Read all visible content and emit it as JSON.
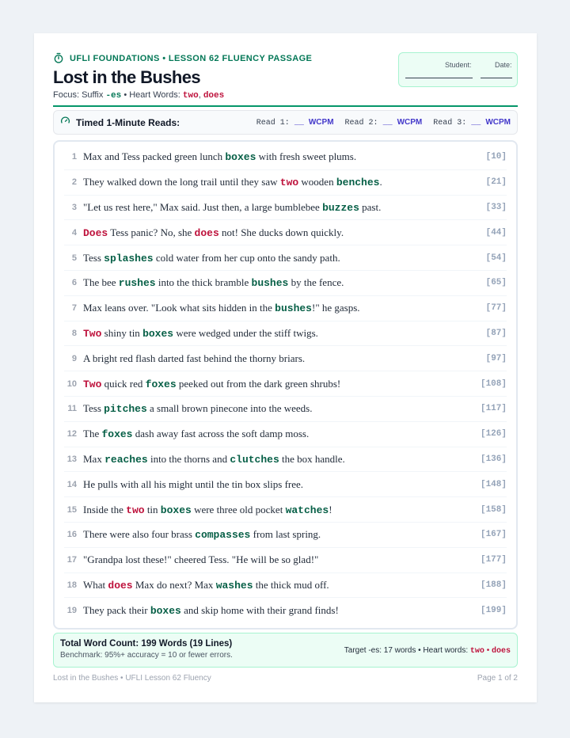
{
  "header": {
    "kicker": "UFLI FOUNDATIONS • LESSON 62 FLUENCY PASSAGE",
    "title": "Lost in the Bushes",
    "focus_prefix": "Focus: Suffix",
    "focus_suffix": "-es",
    "focus_heart_label": "• Heart Words:",
    "heart_word_1": "two",
    "heart_sep": ",",
    "heart_word_2": "does",
    "student_label": "Student:",
    "date_label": "Date:"
  },
  "timed": {
    "label": "Timed 1-Minute Reads:",
    "reads": [
      {
        "label": "Read 1:",
        "blank": "__",
        "unit": "WCPM"
      },
      {
        "label": "Read 2:",
        "blank": "__",
        "unit": "WCPM"
      },
      {
        "label": "Read 3:",
        "blank": "__",
        "unit": "WCPM"
      }
    ]
  },
  "passage": [
    {
      "num": "1",
      "count": "[10]",
      "parts": [
        [
          "t",
          "Max and Tess packed green lunch "
        ],
        [
          "g",
          "boxes"
        ],
        [
          "t",
          " with fresh sweet plums."
        ]
      ]
    },
    {
      "num": "2",
      "count": "[21]",
      "parts": [
        [
          "t",
          "They walked down the long trail until they saw "
        ],
        [
          "r",
          "two"
        ],
        [
          "t",
          " wooden "
        ],
        [
          "g",
          "benches"
        ],
        [
          "t",
          "."
        ]
      ]
    },
    {
      "num": "3",
      "count": "[33]",
      "parts": [
        [
          "t",
          "\"Let us rest here,\" Max said. Just then, a large bumblebee "
        ],
        [
          "g",
          "buzzes"
        ],
        [
          "t",
          " past."
        ]
      ]
    },
    {
      "num": "4",
      "count": "[44]",
      "parts": [
        [
          "r",
          "Does"
        ],
        [
          "t",
          " Tess panic? No, she "
        ],
        [
          "r",
          "does"
        ],
        [
          "t",
          " not! She ducks down quickly."
        ]
      ]
    },
    {
      "num": "5",
      "count": "[54]",
      "parts": [
        [
          "t",
          "Tess "
        ],
        [
          "g",
          "splashes"
        ],
        [
          "t",
          " cold water from her cup onto the sandy path."
        ]
      ]
    },
    {
      "num": "6",
      "count": "[65]",
      "parts": [
        [
          "t",
          "The bee "
        ],
        [
          "g",
          "rushes"
        ],
        [
          "t",
          " into the thick bramble "
        ],
        [
          "g",
          "bushes"
        ],
        [
          "t",
          " by the fence."
        ]
      ]
    },
    {
      "num": "7",
      "count": "[77]",
      "parts": [
        [
          "t",
          "Max leans over. \"Look what sits hidden in the "
        ],
        [
          "g",
          "bushes"
        ],
        [
          "t",
          "!\" he gasps."
        ]
      ]
    },
    {
      "num": "8",
      "count": "[87]",
      "parts": [
        [
          "r",
          "Two"
        ],
        [
          "t",
          " shiny tin "
        ],
        [
          "g",
          "boxes"
        ],
        [
          "t",
          " were wedged under the stiff twigs."
        ]
      ]
    },
    {
      "num": "9",
      "count": "[97]",
      "parts": [
        [
          "t",
          "A bright red flash darted fast behind the thorny briars."
        ]
      ]
    },
    {
      "num": "10",
      "count": "[108]",
      "parts": [
        [
          "r",
          "Two"
        ],
        [
          "t",
          " quick red "
        ],
        [
          "g",
          "foxes"
        ],
        [
          "t",
          " peeked out from the dark green shrubs!"
        ]
      ]
    },
    {
      "num": "11",
      "count": "[117]",
      "parts": [
        [
          "t",
          "Tess "
        ],
        [
          "g",
          "pitches"
        ],
        [
          "t",
          " a small brown pinecone into the weeds."
        ]
      ]
    },
    {
      "num": "12",
      "count": "[126]",
      "parts": [
        [
          "t",
          "The "
        ],
        [
          "g",
          "foxes"
        ],
        [
          "t",
          " dash away fast across the soft damp moss."
        ]
      ]
    },
    {
      "num": "13",
      "count": "[136]",
      "parts": [
        [
          "t",
          "Max "
        ],
        [
          "g",
          "reaches"
        ],
        [
          "t",
          " into the thorns and "
        ],
        [
          "g",
          "clutches"
        ],
        [
          "t",
          " the box handle."
        ]
      ]
    },
    {
      "num": "14",
      "count": "[148]",
      "parts": [
        [
          "t",
          "He pulls with all his might until the tin box slips free."
        ]
      ]
    },
    {
      "num": "15",
      "count": "[158]",
      "parts": [
        [
          "t",
          "Inside the "
        ],
        [
          "r",
          "two"
        ],
        [
          "t",
          " tin "
        ],
        [
          "g",
          "boxes"
        ],
        [
          "t",
          " were three old pocket "
        ],
        [
          "g",
          "watches"
        ],
        [
          "t",
          "!"
        ]
      ]
    },
    {
      "num": "16",
      "count": "[167]",
      "parts": [
        [
          "t",
          "There were also four brass "
        ],
        [
          "g",
          "compasses"
        ],
        [
          "t",
          " from last spring."
        ]
      ]
    },
    {
      "num": "17",
      "count": "[177]",
      "parts": [
        [
          "t",
          "\"Grandpa lost these!\" cheered Tess. \"He will be so glad!\""
        ]
      ]
    },
    {
      "num": "18",
      "count": "[188]",
      "parts": [
        [
          "t",
          "What "
        ],
        [
          "r",
          "does"
        ],
        [
          "t",
          " Max do next? Max "
        ],
        [
          "g",
          "washes"
        ],
        [
          "t",
          " the thick mud off."
        ]
      ]
    },
    {
      "num": "19",
      "count": "[199]",
      "parts": [
        [
          "t",
          "They pack their "
        ],
        [
          "g",
          "boxes"
        ],
        [
          "t",
          " and skip home with their grand finds!"
        ]
      ]
    }
  ],
  "summary": {
    "title": "Total Word Count: 199 Words (19 Lines)",
    "benchmark": "Benchmark: 95%+ accuracy = 10 or fewer errors.",
    "target_prefix": "Target -es: 17 words • Heart words:",
    "heart_1": "two",
    "heart_sep": "•",
    "heart_2": "does"
  },
  "footer": {
    "left": "Lost in the Bushes • UFLI Lesson 62 Fluency",
    "right": "Page 1 of 2"
  },
  "colors": {
    "accent_green": "#047857",
    "heart_red": "#be123c",
    "wcpm_indigo": "#4338ca"
  },
  "icons": {
    "kicker": "stopwatch-icon",
    "timed": "gauge-icon"
  }
}
